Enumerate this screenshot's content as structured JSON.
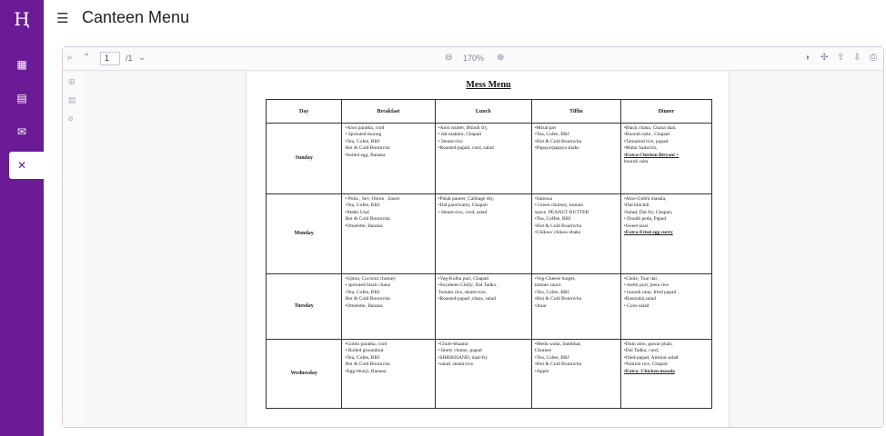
{
  "app": {
    "title": "Canteen Menu",
    "logo": "Ⱨ"
  },
  "sidebar": {
    "items": [
      {
        "name": "dashboard-icon",
        "glyph": "▦"
      },
      {
        "name": "reports-icon",
        "glyph": "▤"
      },
      {
        "name": "mail-icon",
        "glyph": "✉"
      },
      {
        "name": "canteen-icon",
        "glyph": "✕",
        "active": true
      }
    ]
  },
  "toolbar": {
    "page_current": "1",
    "page_total": "/1",
    "zoom": "170%"
  },
  "document": {
    "title": "Mess Menu",
    "columns": [
      "Day",
      "Breakfast",
      "Lunch",
      "Tiffin",
      "Dinner"
    ],
    "rows": [
      {
        "day": "Sunday",
        "breakfast": [
          "•Aloo paratha, curd",
          "• Sprouted moong",
          "•Tea, Cofee, BBJ",
          "Hot & Cold Bournvita",
          "•boiled egg, Banana"
        ],
        "lunch": [
          "•Aloo mutter, Bhindi fry,",
          "• dal makhni, Chapati",
          "• Steam-rice",
          "•Roasted-papad, curd, salad"
        ],
        "tiffin": [
          "•Misal pav",
          "•Tea, Cofee, BBJ",
          "•Hot & Cold Bournvita",
          "•Papaya/papaya shake"
        ],
        "dinner": [
          "•Black chana, Chana daal,",
          "•Boondi raita , Chapati",
          "•Tamarind rice, papad",
          "•Malai Sadwich,",
          "•Extra-Chicken Biryani +",
          "boondi raita"
        ]
      },
      {
        "day": "Monday",
        "breakfast": [
          "• Poha , Sev, Onion , Sauce",
          "•Tea, Cofee, BBJ",
          "•Matki Usal",
          "Hot & Cold Bournvita",
          "•Omelette, Banana"
        ],
        "lunch": [
          "•Palak paneer, Cabbage dry,",
          "•Dal panchratni, Chapati",
          "• Steam-rice, curd, salad"
        ],
        "tiffin": [
          "•Samosa",
          "• Green chutney, tomato",
          "sauce, PEANUT BUTTER",
          "•Tea, Coffee, BBJ",
          "•Hot & Cold Bournvita",
          "•Chikoo/ chikoo-shake"
        ],
        "dinner": [
          "•Aloo-Gobhi masala,",
          "•Dal khichdi",
          "•Salad, Dal fry, Chapati,",
          "• Doodh peda, Papad",
          "•Sweet lassi",
          "•Extra-Fried egg curry"
        ]
      },
      {
        "day": "Tuesday",
        "breakfast": [
          "•Upma, Coconut chutney",
          "• sprouted black chana",
          "•Tea, Cofee, BBJ",
          "Hot & Cold Bournvita",
          "•Omelette, Banana"
        ],
        "lunch": [
          "•Veg-Kolha puri, Chapati",
          "•Soyabeen Chilly, Dal Tadka ,",
          "Tomato rice, steam-rice,",
          "•Roasted-papad ,chass, salad"
        ],
        "tiffin": [
          "•Veg-Cheese burger,",
          "tomato sauce",
          "•Tea, Cofee, BBJ",
          "•Hot & Cold Bournvita",
          "•Anar"
        ],
        "dinner": [
          "•Chole, Tuar dal ,",
          "• methi puri, jeera rice",
          "• boondi raita, fried papad ,",
          "•Rasmalai,salad",
          "• Corn-salad"
        ]
      },
      {
        "day": "Wednesday",
        "breakfast": [
          "•Gobhi paratha, curd",
          "• Boiled groundnut",
          "•Tea, Cofee, BBJ",
          "Hot & Cold Bournvita",
          "•Egg-bhurji, Banana"
        ],
        "lunch": [
          "•Chole-bhaatur",
          "• Imely chutne, papad",
          "•SHRIKHAND, daal-fry",
          "•salad, steam-rice"
        ],
        "tiffin": [
          "•Medu wada, Sambhar,",
          "Chutney",
          "•Tea, Cofee, BBJ",
          "•Hot & Cold Bournvita",
          "•Apple"
        ],
        "dinner": [
          "•Dum aloo, gawar phali,",
          "•Dal Tadka, curd,",
          "•fried-papad, Amroot salad",
          "•Nutrela rice, Chapati",
          "•Extra- Chicken masala"
        ]
      }
    ]
  },
  "colors": {
    "sidebar": "#6b1b96",
    "accent": "#8b7aa6"
  }
}
